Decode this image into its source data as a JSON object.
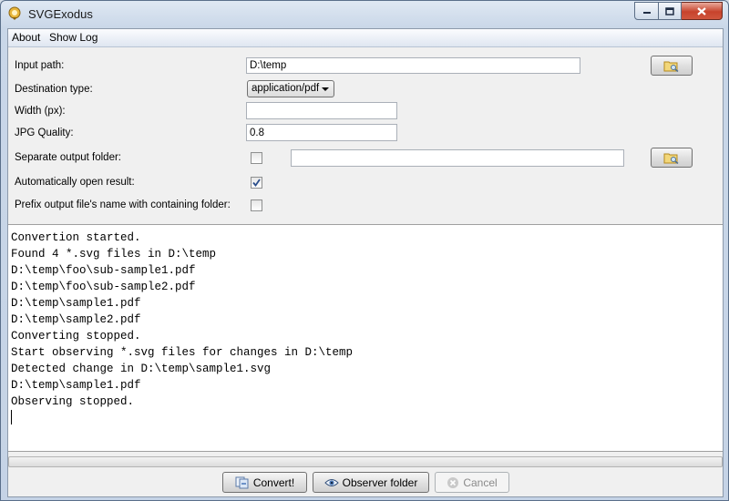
{
  "window": {
    "title": "SVGExodus"
  },
  "menu": {
    "items": [
      "About",
      "Show Log"
    ]
  },
  "form": {
    "input_path": {
      "label": "Input path:",
      "value": "D:\\temp"
    },
    "destination_type": {
      "label": "Destination type:",
      "value": "application/pdf"
    },
    "width": {
      "label": "Width (px):",
      "value": ""
    },
    "jpg_quality": {
      "label": "JPG Quality:",
      "value": "0.8"
    },
    "separate_output": {
      "label": "Separate output folder:",
      "checked": false,
      "value": ""
    },
    "auto_open": {
      "label": "Automatically open result:",
      "checked": true
    },
    "prefix_name": {
      "label": "Prefix output file's name with containing folder:",
      "checked": false
    }
  },
  "log": {
    "lines": [
      "Convertion started.",
      "Found 4 *.svg files in D:\\temp",
      "D:\\temp\\foo\\sub-sample1.pdf",
      "D:\\temp\\foo\\sub-sample2.pdf",
      "D:\\temp\\sample1.pdf",
      "D:\\temp\\sample2.pdf",
      "Converting stopped.",
      "Start observing *.svg files for changes in D:\\temp",
      "Detected change in D:\\temp\\sample1.svg",
      "D:\\temp\\sample1.pdf",
      "Observing stopped."
    ]
  },
  "progress": {
    "value": 0
  },
  "buttons": {
    "convert": "Convert!",
    "observe": "Observer folder",
    "cancel": "Cancel"
  },
  "icons": {
    "app": "svgexodus-icon",
    "browse": "folder-search-icon",
    "convert": "convert-icon",
    "observe": "eye-icon",
    "cancel": "cancel-icon"
  }
}
